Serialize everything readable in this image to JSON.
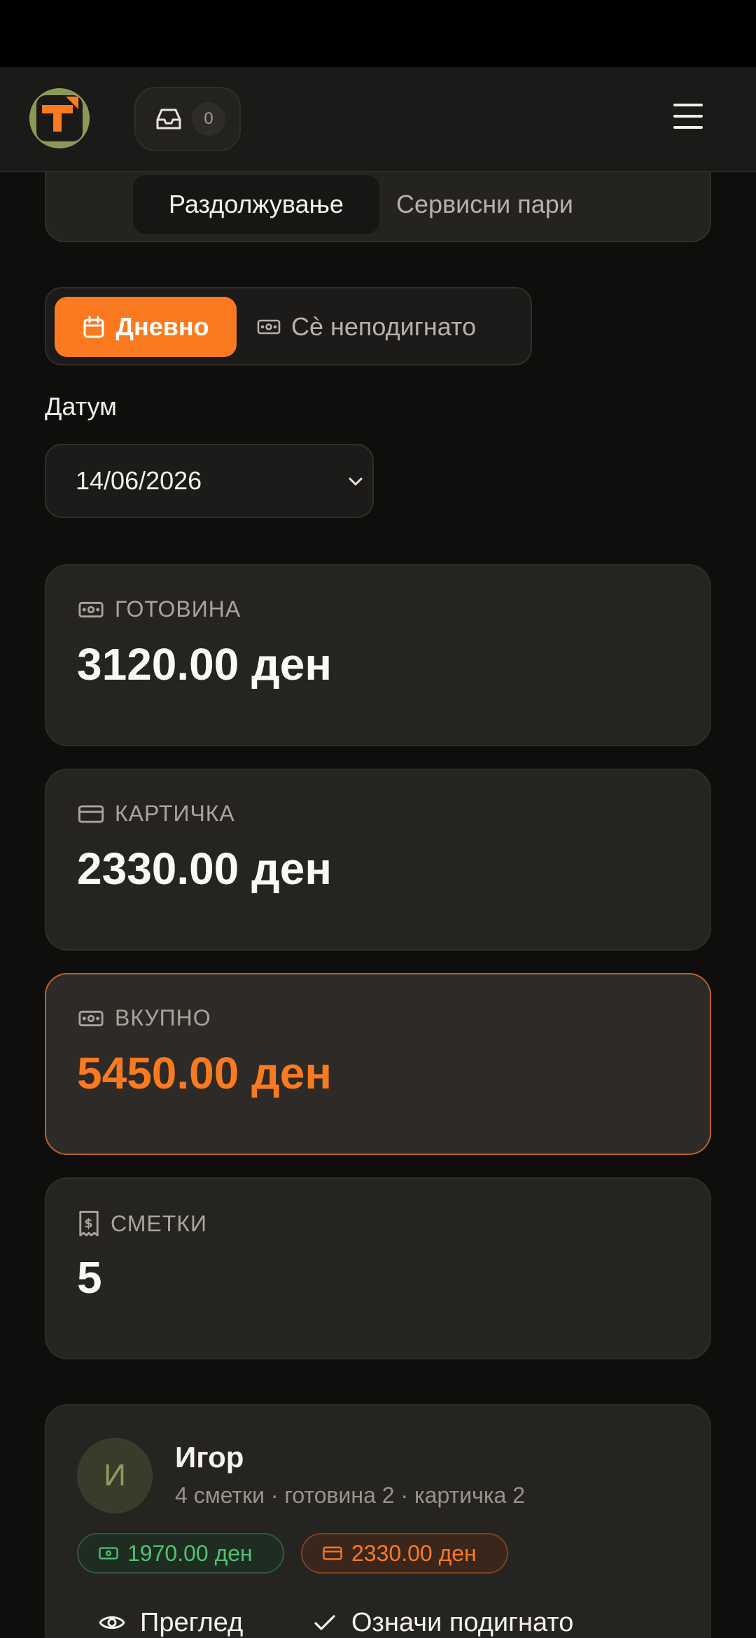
{
  "header": {
    "inbox_count": "0",
    "brand_colors": {
      "accent": "#fb7a1f",
      "logo_bg": "#8a9a55"
    }
  },
  "segment": {
    "active": "Раздолжување",
    "other": "Сервисни пари"
  },
  "mode": {
    "active": "Дневно",
    "other": "Сè неподигнато"
  },
  "date": {
    "label": "Датум",
    "value": "14/06/2026"
  },
  "stats": [
    {
      "label": "ГОТОВИНА",
      "value": "3120.00 ден",
      "icon": "cash-icon"
    },
    {
      "label": "КАРТИЧКА",
      "value": "2330.00 ден",
      "icon": "card-icon"
    },
    {
      "label": "ВКУПНО",
      "value": "5450.00 ден",
      "icon": "cash-icon"
    },
    {
      "label": "СМЕТКИ",
      "value": "5",
      "icon": "receipt-icon"
    }
  ],
  "person": {
    "initial": "И",
    "name": "Игор",
    "meta": "4 сметки · готовина 2 · картичка 2",
    "cash_amount": "1970.00 ден",
    "card_amount": "2330.00 ден",
    "view_label": "Преглед",
    "mark_label": "Означи подигнато"
  }
}
